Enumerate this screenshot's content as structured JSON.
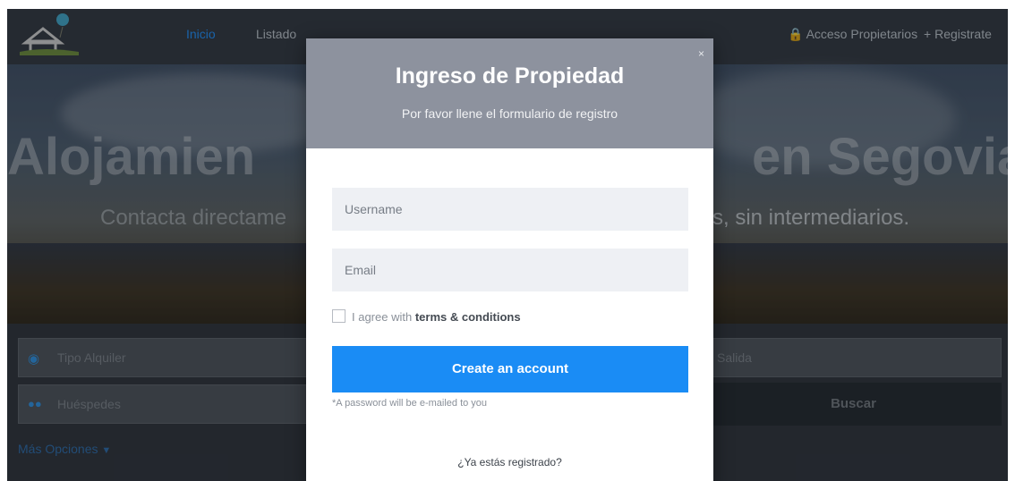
{
  "header": {
    "nav": [
      {
        "label": "Inicio",
        "active": true
      },
      {
        "label": "Listado"
      }
    ],
    "owners_link": "Acceso Propietarios",
    "register_link": "Registrate"
  },
  "hero": {
    "title_left": "Alojamien",
    "title_right": "en Segovia",
    "subtitle_left": "Contacta directame",
    "subtitle_right": "s, sin intermediarios."
  },
  "search": {
    "tipo_alquiler": "Tipo Alquiler",
    "salida": "Salida",
    "huespedes": "Huéspedes",
    "buscar": "Buscar",
    "mas_opciones": "Más Opciones"
  },
  "modal": {
    "close": "×",
    "title": "Ingreso de Propiedad",
    "subtitle": "Por favor llene el formulario de registro",
    "username_placeholder": "Username",
    "email_placeholder": "Email",
    "agree_prefix": "I agree with ",
    "agree_terms": "terms & conditions",
    "create_button": "Create an account",
    "hint": "*A password will be e-mailed to you",
    "already_registered": "¿Ya estás registrado?"
  },
  "colors": {
    "accent": "#1a8cf5",
    "modal_header": "#8d929e"
  }
}
